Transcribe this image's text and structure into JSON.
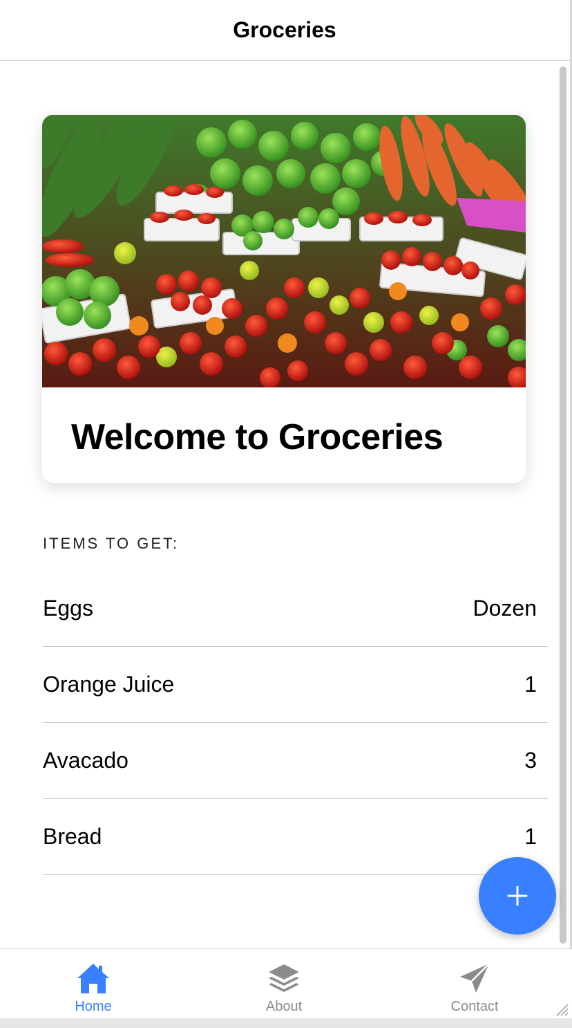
{
  "header": {
    "title": "Groceries"
  },
  "card": {
    "title": "Welcome to Groceries",
    "image_icon": "vegetables-market-photo"
  },
  "list": {
    "header": "ITEMS TO GET:",
    "items": [
      {
        "name": "Eggs",
        "quantity": "Dozen"
      },
      {
        "name": "Orange Juice",
        "quantity": "1"
      },
      {
        "name": "Avacado",
        "quantity": "3"
      },
      {
        "name": "Bread",
        "quantity": "1"
      }
    ]
  },
  "fab": {
    "icon": "add-icon"
  },
  "tabs": [
    {
      "label": "Home",
      "icon": "home-icon",
      "selected": true
    },
    {
      "label": "About",
      "icon": "layers-icon",
      "selected": false
    },
    {
      "label": "Contact",
      "icon": "paper-plane-icon",
      "selected": false
    }
  ],
  "colors": {
    "accent": "#3880ff",
    "inactive_tab": "#8c8c8c"
  }
}
